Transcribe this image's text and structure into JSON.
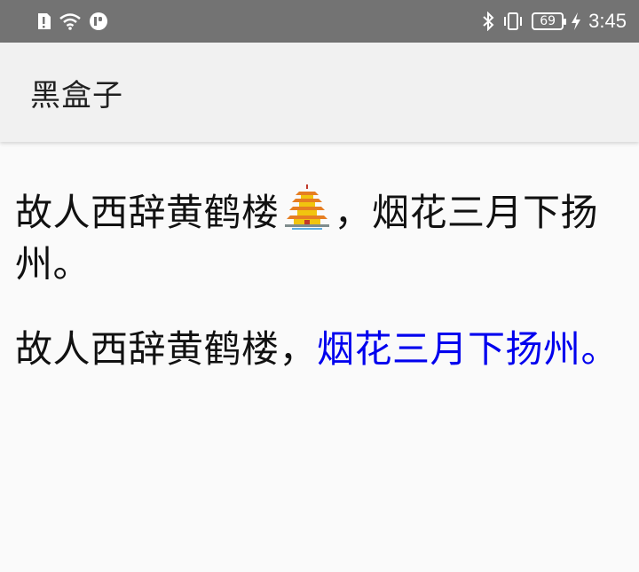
{
  "status_bar": {
    "time": "3:45",
    "battery_level": "69",
    "icons": [
      "alert-icon",
      "wifi-icon",
      "app-notification-icon",
      "bluetooth-icon",
      "vibrate-icon",
      "battery-icon",
      "charging-icon"
    ]
  },
  "app_bar": {
    "title": "黑盒子"
  },
  "content": {
    "para1_before": "故人西辞黄鹤楼",
    "para1_image": "yellow-crane-tower-image",
    "para1_after": "，烟花三月下扬州。",
    "para2_plain": "故人西辞黄鹤楼，",
    "para2_link": "烟花三月下扬州。",
    "link_color": "#0000ee"
  }
}
